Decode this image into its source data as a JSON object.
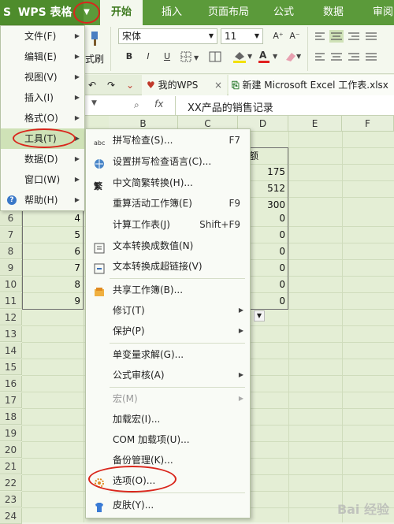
{
  "app": {
    "name": "WPS 表格"
  },
  "ribbon_tabs": [
    "开始",
    "插入",
    "页面布局",
    "公式",
    "数据",
    "审阅"
  ],
  "ribbon": {
    "font_name": "宋体",
    "font_size": "11",
    "paste_label": "式刷",
    "grow_font": "A⁺",
    "shrink_font": "A⁻",
    "bold": "B",
    "italic": "I",
    "underline": "U"
  },
  "doc_tabs": {
    "home": "我的WPS",
    "file": "新建 Microsoft Excel 工作表.xlsx"
  },
  "formula_bar": {
    "fx": "fx",
    "content": "XX产品的销售记录"
  },
  "columns": [
    "B",
    "C",
    "D",
    "E",
    "F"
  ],
  "rows": [
    "6",
    "7",
    "8",
    "9",
    "10",
    "11",
    "12",
    "13",
    "14",
    "15",
    "16",
    "17",
    "18",
    "19",
    "20",
    "21",
    "22",
    "23",
    "24"
  ],
  "cells": {
    "col_a": [
      "4",
      "5",
      "6",
      "7",
      "8",
      "9"
    ],
    "col_d_header": "额",
    "col_d": [
      "175",
      "512",
      "300",
      "0",
      "0",
      "0",
      "0",
      "0",
      "0"
    ]
  },
  "main_menu": [
    {
      "label": "文件(F)",
      "arrow": "▶"
    },
    {
      "label": "编辑(E)",
      "arrow": "▶"
    },
    {
      "label": "视图(V)",
      "arrow": "▶"
    },
    {
      "label": "插入(I)",
      "arrow": "▶"
    },
    {
      "label": "格式(O)",
      "arrow": "▶"
    },
    {
      "label": "工具(T)",
      "arrow": "▶"
    },
    {
      "label": "数据(D)",
      "arrow": "▶"
    },
    {
      "label": "窗口(W)",
      "arrow": "▶"
    },
    {
      "label": "帮助(H)",
      "arrow": "▶"
    }
  ],
  "tools_menu": [
    {
      "label": "拼写检查(S)...",
      "shortcut": "F7"
    },
    {
      "label": "设置拼写检查语言(C)...",
      "shortcut": ""
    },
    {
      "label": "中文简繁转换(H)...",
      "shortcut": ""
    },
    {
      "label": "重算活动工作簿(E)",
      "shortcut": "F9"
    },
    {
      "label": "计算工作表(J)",
      "shortcut": "Shift+F9"
    },
    {
      "label": "文本转换成数值(N)",
      "shortcut": ""
    },
    {
      "label": "文本转换成超链接(V)",
      "shortcut": ""
    },
    {
      "label": "共享工作簿(B)...",
      "shortcut": ""
    },
    {
      "label": "修订(T)",
      "shortcut": ""
    },
    {
      "label": "保护(P)",
      "shortcut": ""
    },
    {
      "label": "单变量求解(G)...",
      "shortcut": ""
    },
    {
      "label": "公式审核(A)",
      "shortcut": ""
    },
    {
      "label": "宏(M)",
      "shortcut": ""
    },
    {
      "label": "加载宏(I)...",
      "shortcut": ""
    },
    {
      "label": "COM 加载项(U)...",
      "shortcut": ""
    },
    {
      "label": "备份管理(K)...",
      "shortcut": ""
    },
    {
      "label": "选项(O)...",
      "shortcut": ""
    },
    {
      "label": "皮肤(Y)...",
      "shortcut": ""
    }
  ],
  "submenu_arrow": "▶",
  "watermark": "Bai 经验",
  "colors": {
    "brand_green": "#5b9a3a",
    "highlight": "#cfe2b7",
    "annotation_red": "#d9261c"
  }
}
